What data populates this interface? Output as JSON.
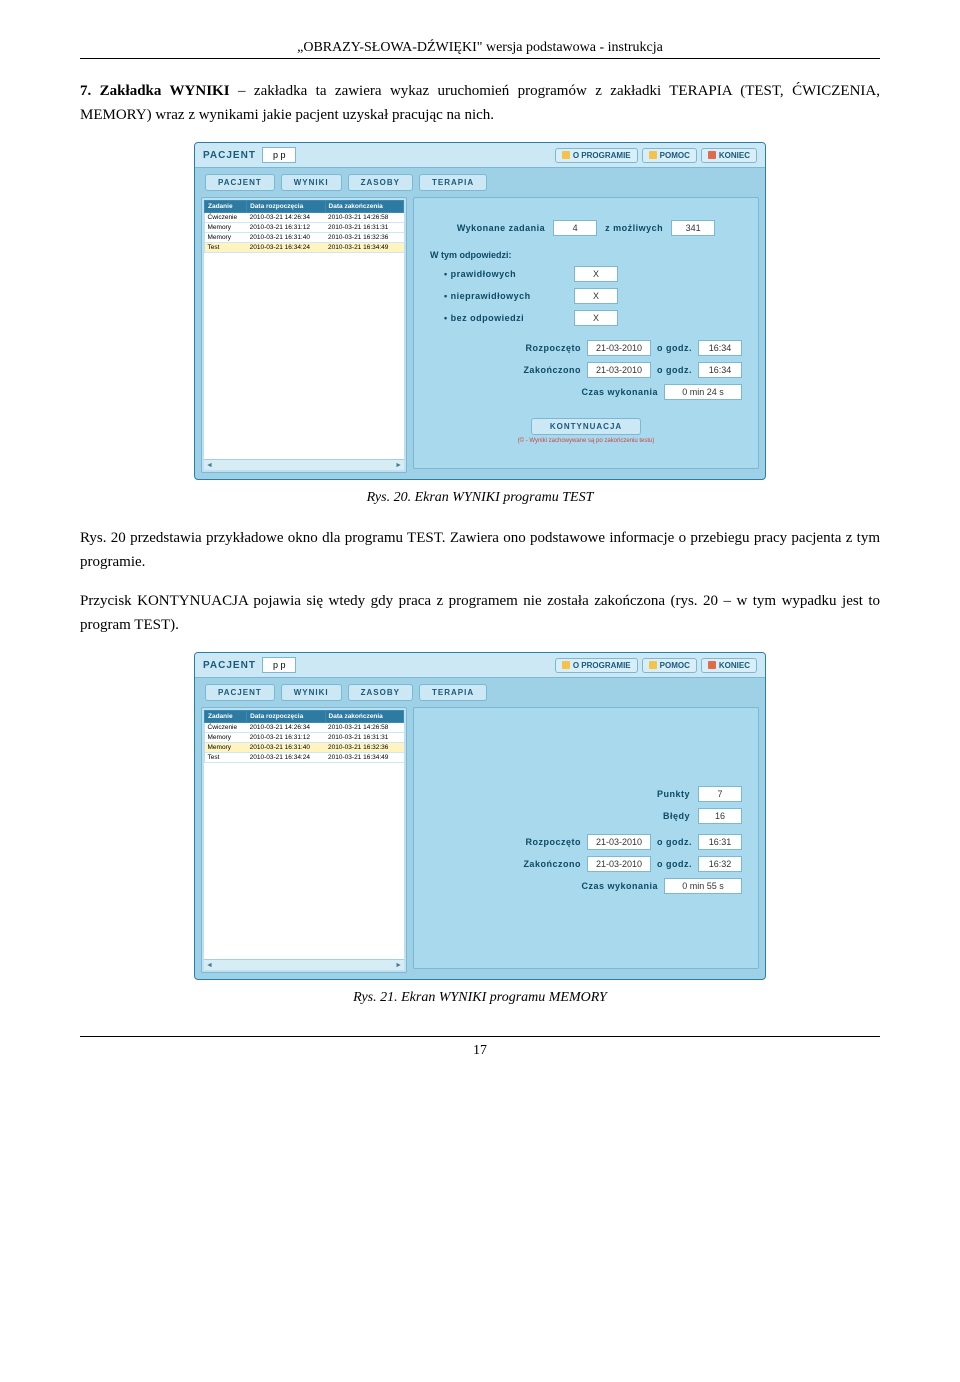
{
  "doc_header": "„OBRAZY-SŁOWA-DŹWIĘKI\" wersja podstawowa - instrukcja",
  "para1_prefix": "7. Zakładka WYNIKI",
  "para1_rest": " – zakładka ta zawiera wykaz uruchomień programów z zakładki TERAPIA (TEST, ĆWICZENIA, MEMORY) wraz z wynikami jakie pacjent uzyskał pracując na nich.",
  "caption1": "Rys. 20. Ekran WYNIKI programu TEST",
  "para2": "Rys. 20 przedstawia przykładowe okno dla programu TEST. Zawiera ono podstawowe informacje o przebiegu pracy pacjenta z tym programie.",
  "para3": "Przycisk KONTYNUACJA pojawia się wtedy gdy praca z programem nie została zakończona (rys. 20 – w tym wypadku jest to program TEST).",
  "caption2": "Rys. 21. Ekran WYNIKI programu MEMORY",
  "page_number": "17",
  "app": {
    "pacjent_label": "PACJENT",
    "pacjent_value": "p p",
    "btn_oprogramie": "O PROGRAMIE",
    "btn_pomoc": "POMOC",
    "btn_koniec": "KONIEC",
    "tabs": {
      "pacjent": "PACJENT",
      "wyniki": "WYNIKI",
      "zasoby": "ZASOBY",
      "terapia": "TERAPIA"
    },
    "table_headers": {
      "zadanie": "Zadanie",
      "start": "Data rozpoczęcia",
      "end": "Data zakończenia"
    },
    "rows": [
      {
        "z": "Ćwiczenie",
        "s": "2010-03-21 14:26:34",
        "e": "2010-03-21 14:26:58"
      },
      {
        "z": "Memory",
        "s": "2010-03-21 16:31:12",
        "e": "2010-03-21 16:31:31"
      },
      {
        "z": "Memory",
        "s": "2010-03-21 16:31:40",
        "e": "2010-03-21 16:32:36"
      },
      {
        "z": "Test",
        "s": "2010-03-21 16:34:24",
        "e": "2010-03-21 16:34:49"
      }
    ],
    "s1": {
      "wykonane_label": "Wykonane zadania",
      "wykonane_val": "4",
      "zmozliwych": "z możliwych",
      "mozliwych_val": "341",
      "wtym": "W tym odpowiedzi:",
      "prawidlowych": "prawidłowych",
      "nieprawidlowych": "nieprawidłowych",
      "bezodp": "bez odpowiedzi",
      "x": "X",
      "rozpoczeto": "Rozpoczęto",
      "ogodz": "o godz.",
      "zakonczono": "Zakończono",
      "czas": "Czas wykonania",
      "data1": "21-03-2010",
      "godz1": "16:34",
      "data2": "21-03-2010",
      "godz2": "16:34",
      "czas_val": "0 min 24 s",
      "kont": "KONTYNUACJA",
      "red": "(© - Wyniki zachowywane są po zakończeniu testu)"
    },
    "s2": {
      "punkty": "Punkty",
      "punkty_val": "7",
      "bledy": "Błędy",
      "bledy_val": "16",
      "rozpoczeto": "Rozpoczęto",
      "ogodz": "o godz.",
      "zakonczono": "Zakończono",
      "czas": "Czas wykonania",
      "data1": "21-03-2010",
      "godz1": "16:31",
      "data2": "21-03-2010",
      "godz2": "16:32",
      "czas_val": "0 min 55 s"
    }
  }
}
